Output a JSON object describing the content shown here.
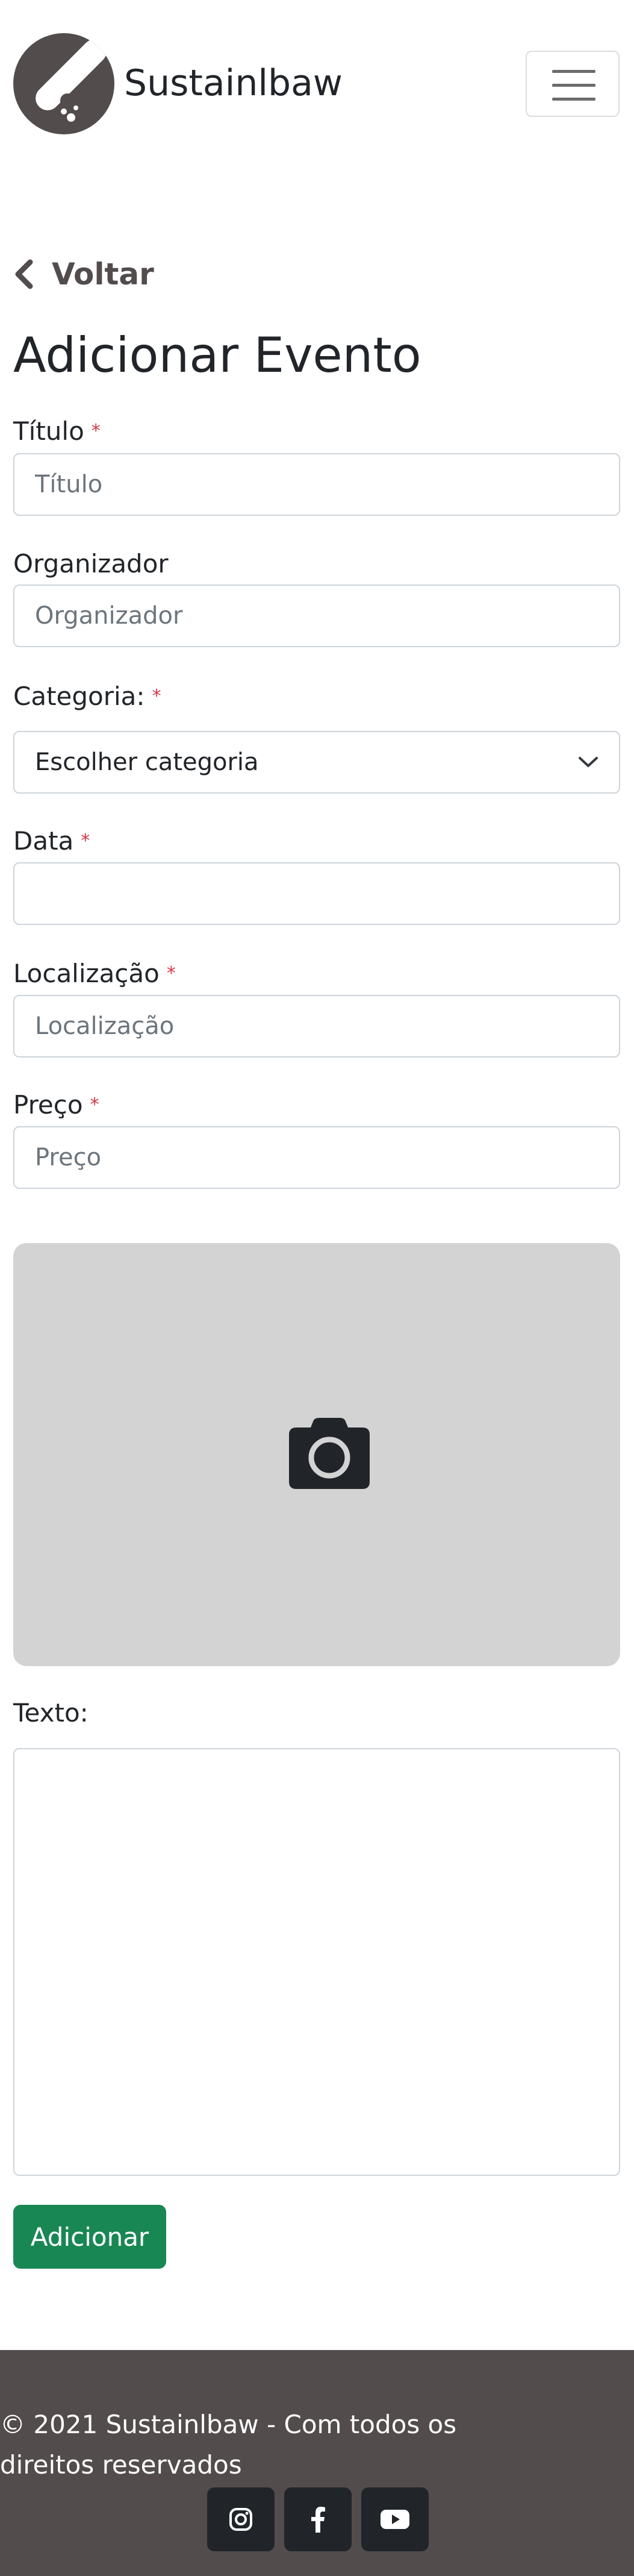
{
  "header": {
    "brand": "Sustainlbaw",
    "logo_icon": "skateboard-icon",
    "menu_icon": "hamburger-icon"
  },
  "back": {
    "label": "Voltar",
    "icon": "chevron-left-icon"
  },
  "page_title": "Adicionar Evento",
  "form": {
    "title": {
      "label": "Título",
      "placeholder": "Título",
      "value": ""
    },
    "organizer": {
      "label": "Organizador",
      "placeholder": "Organizador",
      "value": ""
    },
    "category": {
      "label": "Categoria:",
      "selected": "Escolher categoria"
    },
    "date": {
      "label": "Data",
      "value": ""
    },
    "location": {
      "label": "Localização",
      "placeholder": "Localização",
      "value": ""
    },
    "price": {
      "label": "Preço",
      "placeholder": "Preço",
      "value": ""
    },
    "required_mark": "*",
    "photo_icon": "camera-icon",
    "text": {
      "label": "Texto:",
      "value": ""
    },
    "submit_label": "Adicionar"
  },
  "footer": {
    "copyright": "© 2021 Sustainlbaw - Com todos os direitos reservados",
    "socials": [
      "instagram-icon",
      "facebook-icon",
      "youtube-icon"
    ]
  },
  "colors": {
    "brand_dark": "#524c4c",
    "accent_green": "#198754",
    "required_red": "#dc3545",
    "photo_bg": "#d3d3d3"
  }
}
